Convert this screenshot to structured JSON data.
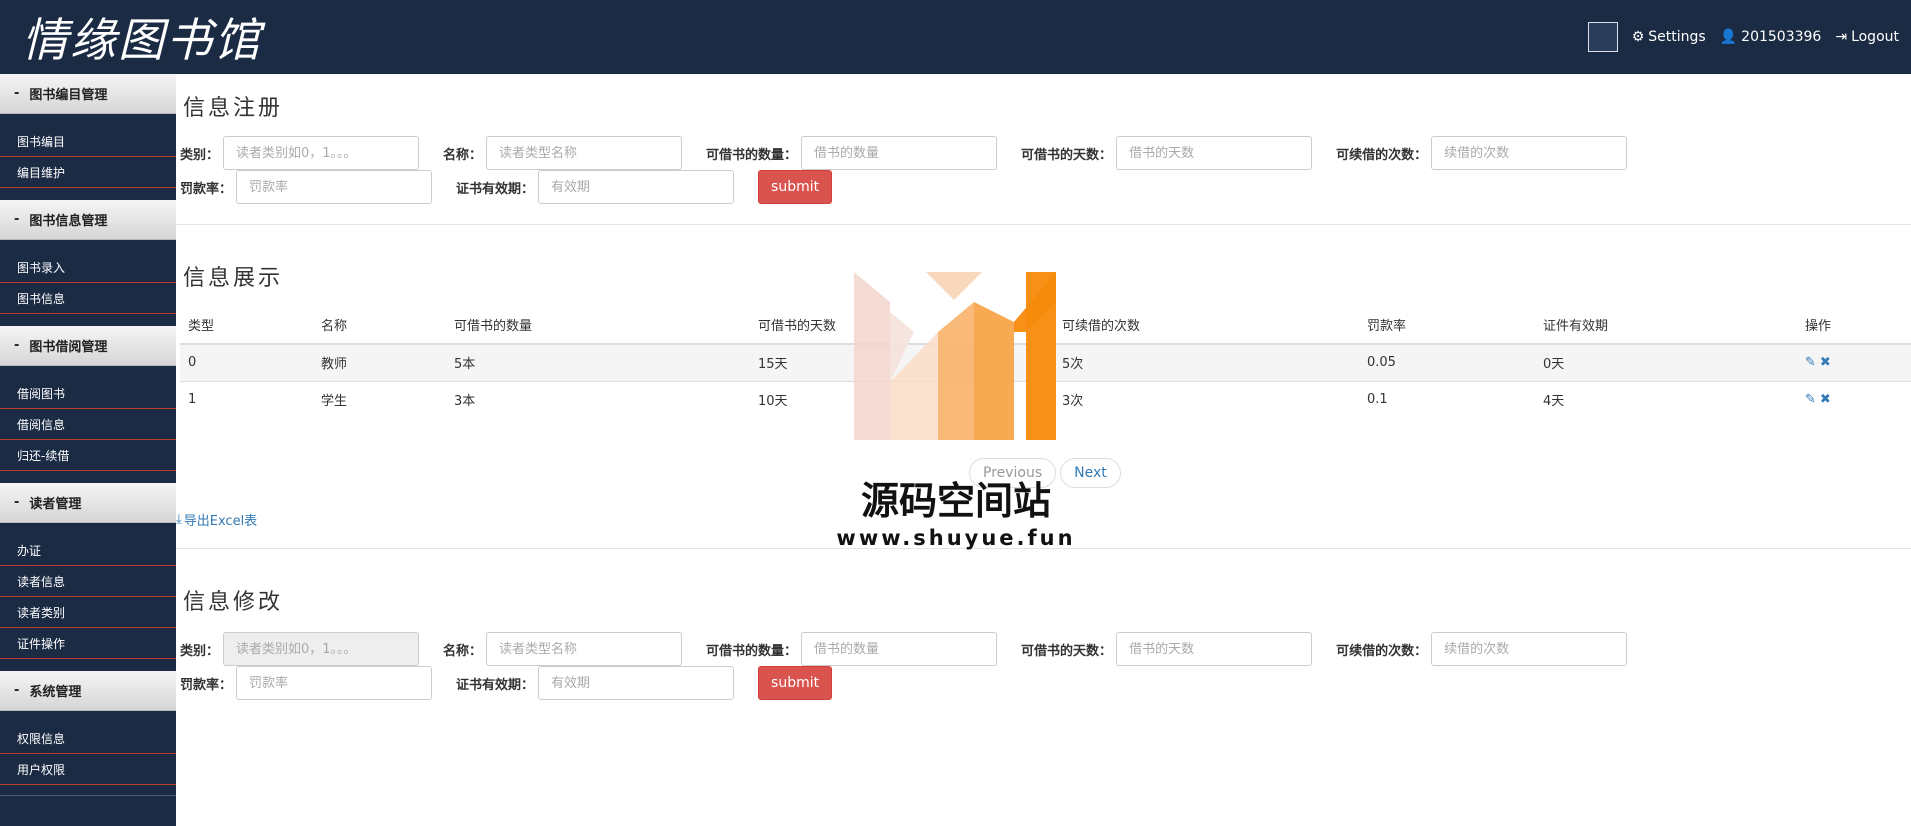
{
  "header": {
    "logo_text": "情缘图书馆",
    "settings_label": "Settings",
    "user_label": "201503396",
    "logout_label": "Logout"
  },
  "sidebar": {
    "groups": [
      {
        "title": "图书编目管理",
        "items": [
          "图书编目",
          "编目维护"
        ]
      },
      {
        "title": "图书信息管理",
        "items": [
          "图书录入",
          "图书信息"
        ]
      },
      {
        "title": "图书借阅管理",
        "items": [
          "借阅图书",
          "借阅信息",
          "归还-续借"
        ]
      },
      {
        "title": "读者管理",
        "items": [
          "办证",
          "读者信息",
          "读者类别",
          "证件操作"
        ]
      },
      {
        "title": "系统管理",
        "items": [
          "权限信息",
          "用户权限"
        ]
      }
    ]
  },
  "register": {
    "title": "信息注册",
    "type_label": "类别：",
    "type_placeholder": "读者类别如0，1。。。",
    "name_label": "名称：",
    "name_placeholder": "读者类型名称",
    "count_label": "可借书的数量：",
    "count_placeholder": "借书的数量",
    "days_label": "可借书的天数：",
    "days_placeholder": "借书的天数",
    "renew_label": "可续借的次数：",
    "renew_placeholder": "续借的次数",
    "fine_label": "罚款率：",
    "fine_placeholder": "罚款率",
    "valid_label": "证书有效期：",
    "valid_placeholder": "有效期",
    "submit_label": "submit"
  },
  "display": {
    "title": "信息展示",
    "columns": [
      "类型",
      "名称",
      "可借书的数量",
      "可借书的天数",
      "可续借的次数",
      "罚款率",
      "证件有效期",
      "操作"
    ],
    "rows": [
      [
        "0",
        "教师",
        "5本",
        "15天",
        "5次",
        "0.05",
        "0天"
      ],
      [
        "1",
        "学生",
        "3本",
        "10天",
        "3次",
        "0.1",
        "4天"
      ]
    ],
    "edit_icon": "✎",
    "delete_icon": "✖",
    "prev_label": "Previous",
    "next_label": "Next",
    "export_label": "导出Excel表"
  },
  "edit": {
    "title": "信息修改",
    "type_label": "类别：",
    "type_placeholder": "读者类别如0，1。。。",
    "name_label": "名称：",
    "name_placeholder": "读者类型名称",
    "count_label": "可借书的数量：",
    "count_placeholder": "借书的数量",
    "days_label": "可借书的天数：",
    "days_placeholder": "借书的天数",
    "renew_label": "可续借的次数：",
    "renew_placeholder": "续借的次数",
    "fine_label": "罚款率：",
    "fine_placeholder": "罚款率",
    "valid_label": "证书有效期：",
    "valid_placeholder": "有效期",
    "submit_label": "submit"
  },
  "watermark": {
    "text": "源码空间站",
    "url": "www.shuyue.fun"
  },
  "colors": {
    "nav_bg": "#1b2b44",
    "submit_bg": "#d9534f",
    "link": "#337ab7",
    "sidebar_divider": "#c0392b"
  }
}
